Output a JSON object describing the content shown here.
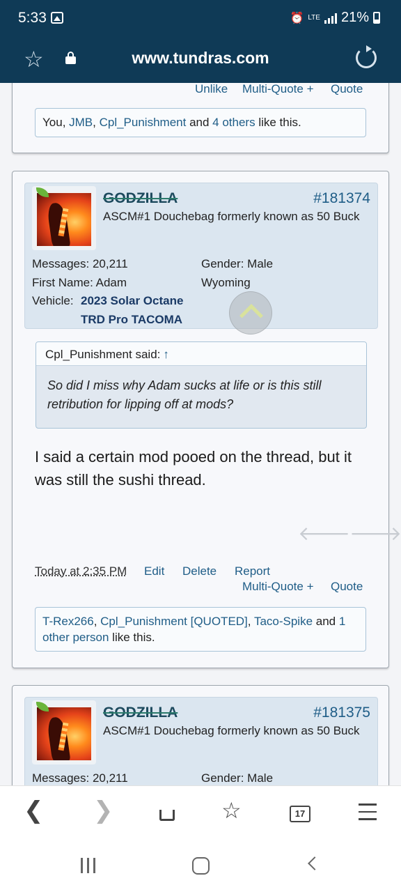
{
  "status_bar": {
    "time": "5:33",
    "network": "LTE",
    "battery": "21%"
  },
  "browser": {
    "url": "www.tundras.com",
    "tabs_count": "17"
  },
  "prev_post": {
    "unlike": "Unlike",
    "multi_quote": "Multi-Quote +",
    "quote": "Quote",
    "likes": {
      "you": "You, ",
      "u1": "JMB",
      "sep1": ", ",
      "u2": "Cpl_Punishment",
      "and": " and ",
      "others": "4 others",
      "tail": " like this."
    }
  },
  "post1": {
    "username": "GODZILLA",
    "post_number": "#181374",
    "user_title": "ASCM#1 Douchebag formerly known as 50 Buck",
    "messages_label": "Messages:",
    "messages_value": "20,211",
    "first_name_label": "First Name:",
    "first_name_value": "Adam",
    "vehicle_label": "Vehicle:",
    "vehicle_line1": "2023 Solar Octane",
    "vehicle_line2": "TRD Pro TACOMA",
    "gender_label": "Gender:",
    "gender_value": "Male",
    "location": "Wyoming",
    "quote_author": "Cpl_Punishment said:",
    "quote_arrow": "↑",
    "quote_text": "So did I miss why Adam sucks at life or is this still retribution for lipping off at mods?",
    "message": "I said a certain mod pooed on the thread, but it was still the sushi thread.",
    "arrow_left": "🡐",
    "arrow_right": "🡒",
    "date": "Today at 2:35 PM",
    "edit": "Edit",
    "delete": "Delete",
    "report": "Report",
    "multi_quote": "Multi-Quote +",
    "quote": "Quote",
    "likes": {
      "u1": "T-Rex266",
      "sep1": ", ",
      "u2": "Cpl_Punishment [QUOTED]",
      "sep2": ", ",
      "u3": "Taco-Spike",
      "and": " and ",
      "n": "1",
      "other": "other person",
      "tail": " like this."
    }
  },
  "post2": {
    "username": "GODZILLA",
    "post_number": "#181375",
    "user_title": "ASCM#1 Douchebag formerly known as 50 Buck",
    "messages_label": "Messages:",
    "messages_value": "20,211",
    "gender_label": "Gender:",
    "gender_value": "Male"
  },
  "toolbar_icons": [
    "back-icon",
    "forward-icon",
    "home-icon",
    "bookmarks-icon",
    "tabs-icon",
    "menu-icon"
  ]
}
